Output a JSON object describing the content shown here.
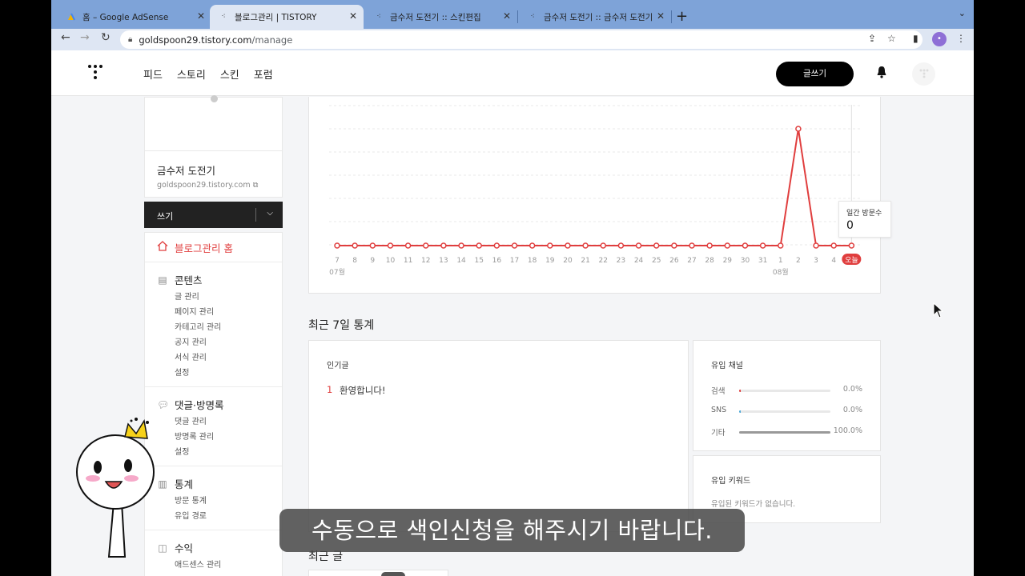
{
  "browser": {
    "tabs": [
      {
        "title": "홈 – Google AdSense",
        "active": false
      },
      {
        "title": "블로그관리 | TISTORY",
        "active": true
      },
      {
        "title": "금수저 도전기 :: 스킨편집",
        "active": false
      },
      {
        "title": "금수저 도전기 :: 금수저 도전기",
        "active": false
      }
    ],
    "url_host": "goldspoon29.tistory.com",
    "url_path": "/manage",
    "profile_initial": "•"
  },
  "header": {
    "nav": [
      "피드",
      "스토리",
      "스킨",
      "포럼"
    ],
    "write_button": "글쓰기"
  },
  "sidebar": {
    "blog_name": "금수저 도전기",
    "blog_url": "goldspoon29.tistory.com",
    "write_dropdown": "쓰기",
    "home_label": "블로그관리 홈",
    "sections": [
      {
        "title": "콘텐츠",
        "icon": "document-icon",
        "items": [
          "글 관리",
          "페이지 관리",
          "카테고리 관리",
          "공지 관리",
          "서식 관리",
          "설정"
        ]
      },
      {
        "title": "댓글·방명록",
        "icon": "comment-icon",
        "items": [
          "댓글 관리",
          "방명록 관리",
          "설정"
        ]
      },
      {
        "title": "통계",
        "icon": "bar-chart-icon",
        "items": [
          "방문 통계",
          "유입 경로"
        ]
      },
      {
        "title": "수익",
        "icon": "revenue-icon",
        "items": [
          "애드센스 관리"
        ]
      }
    ]
  },
  "chart_data": {
    "type": "line",
    "categories": [
      "7",
      "8",
      "9",
      "10",
      "11",
      "12",
      "13",
      "14",
      "15",
      "16",
      "17",
      "18",
      "19",
      "20",
      "21",
      "22",
      "23",
      "24",
      "25",
      "26",
      "27",
      "28",
      "29",
      "30",
      "31",
      "1",
      "2",
      "3",
      "4",
      "오늘"
    ],
    "month_labels": [
      {
        "at": "7",
        "text": "07월"
      },
      {
        "at": "1",
        "text": "08월"
      }
    ],
    "series": [
      {
        "values": [
          0,
          0,
          0,
          0,
          0,
          0,
          0,
          0,
          0,
          0,
          0,
          0,
          0,
          0,
          0,
          0,
          0,
          0,
          0,
          0,
          0,
          0,
          0,
          0,
          0,
          0,
          1,
          0,
          0,
          0
        ]
      }
    ],
    "grid": true,
    "tooltip": {
      "label": "일간 방문수",
      "value": "0"
    },
    "line_color": "#e03e3e"
  },
  "stats": {
    "section_title": "최근 7일 통계",
    "popular": {
      "title": "인기글",
      "items": [
        {
          "rank": "1",
          "title": "환영합니다!"
        }
      ]
    },
    "channels": {
      "title": "유입 채널",
      "rows": [
        {
          "name": "검색",
          "pct": "0.0%",
          "ratio": 0.0,
          "color": "#e03e3e"
        },
        {
          "name": "SNS",
          "pct": "0.0%",
          "ratio": 0.0,
          "color": "#4aa8d8"
        },
        {
          "name": "기타",
          "pct": "100.0%",
          "ratio": 1.0,
          "color": "#999999"
        }
      ]
    },
    "keywords": {
      "title": "유입 키워드",
      "empty": "유입된 키워드가 없습니다."
    },
    "recent_title": "최근 글"
  },
  "overlay": {
    "subtitle": "수동으로 색인신청을 해주시기 바랍니다."
  }
}
